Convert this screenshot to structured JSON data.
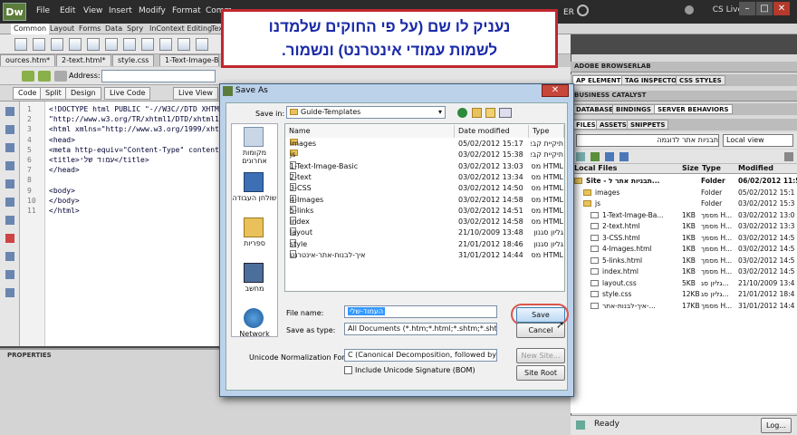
{
  "app": {
    "logo": "Dw",
    "menu": [
      "File",
      "Edit",
      "View",
      "Insert",
      "Modify",
      "Format",
      "Comm"
    ],
    "right_label": "ER",
    "cs_live": "CS Live",
    "insert_tabs": [
      "Common",
      "Layout",
      "Forms",
      "Data",
      "Spry",
      "InContext Editing",
      "Text"
    ],
    "doc_tabs": [
      "ources.htm*",
      "2-text.html*",
      "style.css",
      "1-Text-Image-Basic"
    ],
    "address_label": "Address:",
    "view_buttons": [
      "Code",
      "Split",
      "Design",
      "Live Code",
      "Live View"
    ],
    "properties_title": "PROPERTIES"
  },
  "code": {
    "line_numbers": [
      "1",
      "2",
      "3",
      "4",
      "5",
      "6",
      "7",
      "8",
      "9",
      "10",
      "11"
    ],
    "lines": [
      "<!DOCTYPE html PUBLIC \"-//W3C//DTD XHTM",
      "\"http://www.w3.org/TR/xhtml1/DTD/xhtml1",
      "<html xmlns=\"http://www.w3.org/1999/xht",
      "<head>",
      "<meta http-equiv=\"Content-Type\" content",
      "<title>עמוד שלי</title>",
      "</head>",
      "",
      "<body>",
      "</body>",
      "</html>"
    ]
  },
  "callout": {
    "line1": "נעניק לו שם (על פי החוקים שלמדנו",
    "line2": "לשמות עמודי אינטרנט) ונשמור."
  },
  "panels": {
    "browserlab": "ADOBE BROWSERLAB",
    "tabs1": [
      "AP ELEMENTS",
      "TAG INSPECTOR",
      "CSS STYLES"
    ],
    "catalyst": "BUSINESS CATALYST",
    "tabs2": [
      "DATABASES",
      "BINDINGS",
      "SERVER BEHAVIORS"
    ],
    "tabs3": [
      "FILES",
      "ASSETS",
      "SNIPPETS"
    ],
    "site_select": "תבניות אתר לדוגמה",
    "view_select": "Local view",
    "columns": [
      "Local Files",
      "Size",
      "Type",
      "Modified"
    ],
    "files": [
      {
        "name": "Site - תבניות אתר ל...",
        "size": "",
        "type": "Folder",
        "modified": "06/02/2012 11:5"
      },
      {
        "name": "images",
        "size": "",
        "type": "Folder",
        "modified": "05/02/2012 15:1"
      },
      {
        "name": "js",
        "size": "",
        "type": "Folder",
        "modified": "03/02/2012 15:3"
      },
      {
        "name": "1-Text-Image-Ba...",
        "size": "1KB",
        "type": "מסמך H...",
        "modified": "03/02/2012 13:0"
      },
      {
        "name": "2-text.html",
        "size": "1KB",
        "type": "מסמך H...",
        "modified": "03/02/2012 13:3"
      },
      {
        "name": "3-CSS.html",
        "size": "1KB",
        "type": "מסמך H...",
        "modified": "03/02/2012 14:5"
      },
      {
        "name": "4-Images.html",
        "size": "1KB",
        "type": "מסמך H...",
        "modified": "03/02/2012 14:5"
      },
      {
        "name": "5-links.html",
        "size": "1KB",
        "type": "מסמך H...",
        "modified": "03/02/2012 14:5"
      },
      {
        "name": "index.html",
        "size": "1KB",
        "type": "מסמך H...",
        "modified": "03/02/2012 14:5"
      },
      {
        "name": "layout.css",
        "size": "5KB",
        "type": "גליון סג...",
        "modified": "21/10/2009 13:4"
      },
      {
        "name": "style.css",
        "size": "12KB",
        "type": "גליון סג...",
        "modified": "21/01/2012 18:4"
      },
      {
        "name": "איך-לבנות-אתר-...",
        "size": "17KB",
        "type": "מסמך H...",
        "modified": "31/01/2012 14:4"
      }
    ],
    "status": "Ready",
    "log_button": "Log..."
  },
  "dialog": {
    "title": "Save As",
    "save_in_label": "Save in:",
    "save_in_value": "Guide-Templates",
    "places": [
      "מקומות אחרונים",
      "שולחן העבודה",
      "ספריות",
      "מחשב",
      "Network"
    ],
    "columns": [
      "Name",
      "Date modified",
      "Type"
    ],
    "rows": [
      {
        "name": "images",
        "date": "05/02/2012 15:17",
        "type": "תיקיית קבצים",
        "kind": "folder"
      },
      {
        "name": "js",
        "date": "03/02/2012 15:38",
        "type": "תיקיית קבצים",
        "kind": "folder"
      },
      {
        "name": "1-Text-Image-Basic",
        "date": "03/02/2012 13:03",
        "type": "HTML מסמך",
        "kind": "file"
      },
      {
        "name": "2-text",
        "date": "03/02/2012 13:34",
        "type": "HTML מסמך",
        "kind": "file"
      },
      {
        "name": "3-CSS",
        "date": "03/02/2012 14:50",
        "type": "HTML מסמך",
        "kind": "file"
      },
      {
        "name": "4-Images",
        "date": "03/02/2012 14:58",
        "type": "HTML מסמך",
        "kind": "file"
      },
      {
        "name": "5-links",
        "date": "03/02/2012 14:51",
        "type": "HTML מסמך",
        "kind": "file"
      },
      {
        "name": "index",
        "date": "03/02/2012 14:58",
        "type": "HTML מסמך",
        "kind": "file"
      },
      {
        "name": "layout",
        "date": "21/10/2009 13:48",
        "type": "גליון סגנון",
        "kind": "file"
      },
      {
        "name": "style",
        "date": "21/01/2012 18:46",
        "type": "גליון סגנון",
        "kind": "file"
      },
      {
        "name": "איך-לבנות-אתר-אינטרנט",
        "date": "31/01/2012 14:44",
        "type": "HTML מסמך",
        "kind": "file"
      }
    ],
    "filename_label": "File name:",
    "filename_value": "העמוד-שלי",
    "savetype_label": "Save as type:",
    "savetype_value": "All Documents (*.htm;*.html;*.shtm;*.shtml;*.hta;*",
    "unicode_label": "Unicode Normalization Form:",
    "unicode_value": "C (Canonical Decomposition, followed by Canc",
    "bom_label": "Include Unicode Signature (BOM)",
    "save_button": "Save",
    "cancel_button": "Cancel",
    "newsite_button": "New Site...",
    "siteroot_button": "Site Root"
  }
}
